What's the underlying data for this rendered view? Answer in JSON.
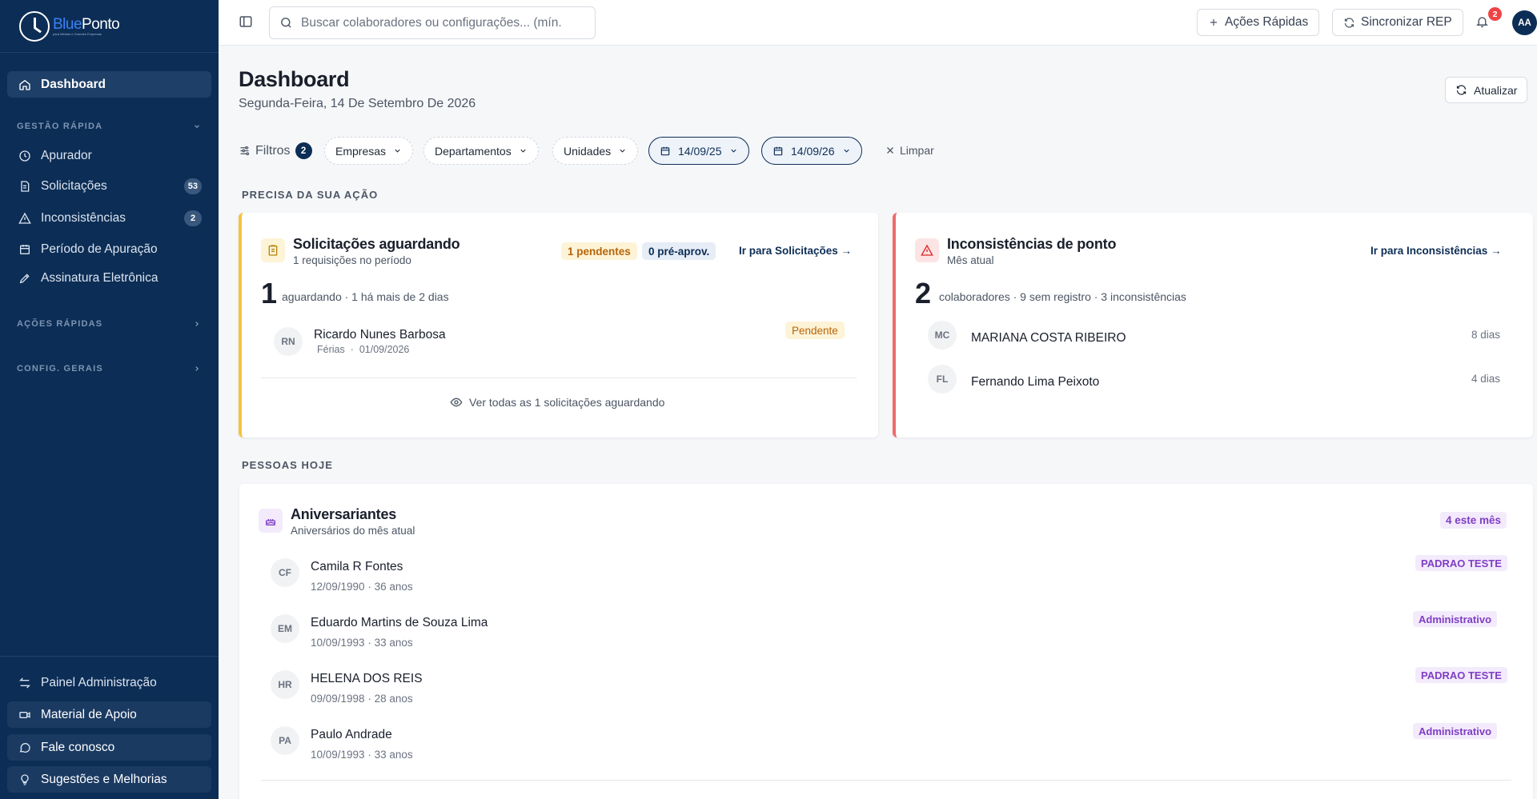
{
  "brand": {
    "name_part1": "Blue",
    "name_part2": "Ponto",
    "tagline": "para Médias e Grandes Empresas"
  },
  "sidebar": {
    "dashboard": "Dashboard",
    "section_gestao": "GESTÃO RÁPIDA",
    "items": [
      {
        "label": "Apurador",
        "icon": "clock-icon"
      },
      {
        "label": "Solicitações",
        "icon": "document-icon",
        "badge": "53"
      },
      {
        "label": "Inconsistências",
        "icon": "warning-icon",
        "badge": "2"
      },
      {
        "label": "Período de Apuração",
        "icon": "calendar-icon"
      },
      {
        "label": "Assinatura Eletrônica",
        "icon": "signature-icon"
      }
    ],
    "section_acoes": "AÇÕES RÁPIDAS",
    "section_config": "CONFIG. GERAIS",
    "bottom": [
      {
        "label": "Painel Administração",
        "icon": "arrows-icon"
      },
      {
        "label": "Material de Apoio",
        "icon": "video-icon"
      },
      {
        "label": "Fale conosco",
        "icon": "chat-icon"
      },
      {
        "label": "Sugestões e Melhorias",
        "icon": "lightbulb-icon"
      }
    ]
  },
  "topbar": {
    "search_placeholder": "Buscar colaboradores ou configurações... (mín.",
    "quick_actions": "Ações Rápidas",
    "sync_rep": "Sincronizar REP",
    "notifications_count": "2",
    "user_initials": "AA"
  },
  "header": {
    "title": "Dashboard",
    "date": "Segunda-Feira, 14 De Setembro De 2026",
    "refresh": "Atualizar"
  },
  "filters": {
    "label": "Filtros",
    "count": "2",
    "empresas": "Empresas",
    "departamentos": "Departamentos",
    "unidades": "Unidades",
    "date_start": "14/09/25",
    "date_end": "14/09/26",
    "clear": "Limpar"
  },
  "sections": {
    "action": "PRECISA DA SUA AÇÃO",
    "people": "PESSOAS HOJE"
  },
  "requests_card": {
    "title": "Solicitações aguardando",
    "subtitle": "1 requisições no período",
    "pending_pill": "1 pendentes",
    "preapproved_pill": "0 pré-aprov.",
    "link": "Ir para Solicitações →",
    "count": "1",
    "count_desc": "aguardando · 1 há mais de 2 dias",
    "item": {
      "initials": "RN",
      "name": "Ricardo Nunes Barbosa",
      "type": "Férias",
      "sep": "·",
      "date": "01/09/2026",
      "status": "Pendente"
    },
    "view_all": "Ver todas as 1 solicitações aguardando"
  },
  "inconsistencies_card": {
    "title": "Inconsistências de ponto",
    "subtitle": "Mês atual",
    "link": "Ir para Inconsistências →",
    "count": "2",
    "count_desc": "colaboradores · 9 sem registro · 3 inconsistências",
    "items": [
      {
        "initials": "MC",
        "name": "MARIANA COSTA RIBEIRO",
        "days": "8 dias"
      },
      {
        "initials": "FL",
        "name": "Fernando Lima Peixoto",
        "days": "4 dias"
      }
    ]
  },
  "birthdays_card": {
    "title": "Aniversariantes",
    "subtitle": "Aniversários do mês atual",
    "badge": "4 este mês",
    "items": [
      {
        "initials": "CF",
        "name": "Camila R Fontes",
        "meta": "12/09/1990 · 36 anos",
        "tag": "PADRAO TESTE"
      },
      {
        "initials": "EM",
        "name": "Eduardo Martins de Souza Lima",
        "meta": "10/09/1993 · 33 anos",
        "tag": "Administrativo"
      },
      {
        "initials": "HR",
        "name": "HELENA DOS REIS",
        "meta": "09/09/1998 · 28 anos",
        "tag": "PADRAO TESTE"
      },
      {
        "initials": "PA",
        "name": "Paulo Andrade",
        "meta": "10/09/1993 · 33 anos",
        "tag": "Administrativo"
      }
    ]
  },
  "colors": {
    "sidebar": "#0c2d55",
    "accent_yellow": "#f2c53d",
    "accent_red": "#ef6b6b",
    "purple_tag": "#7e3fc4"
  }
}
